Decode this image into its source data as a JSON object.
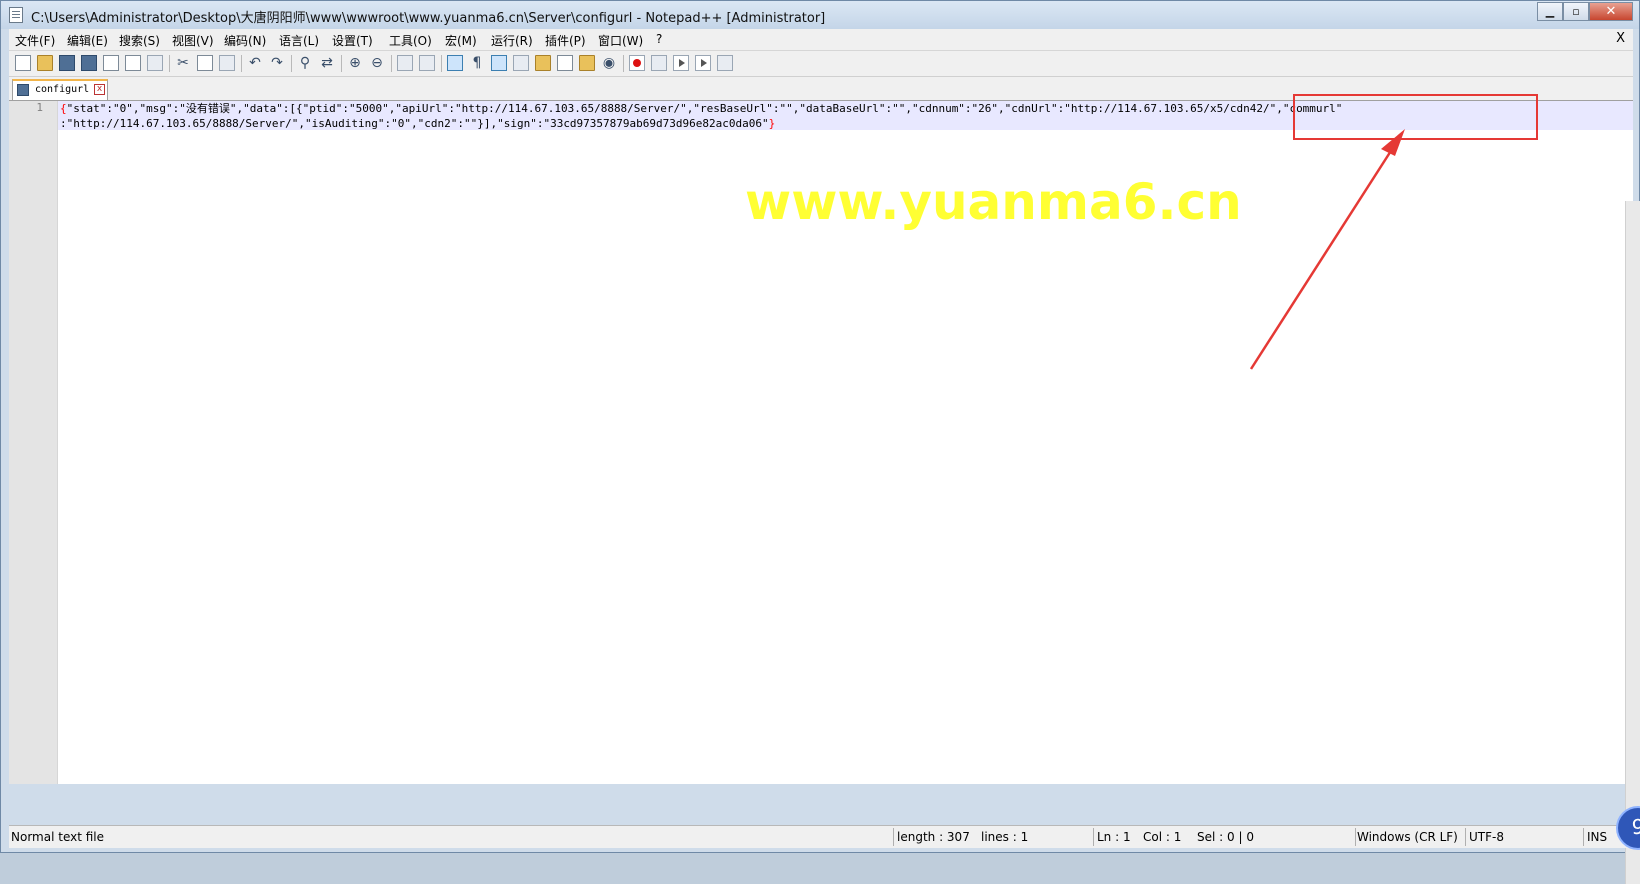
{
  "window": {
    "title": "C:\\Users\\Administrator\\Desktop\\大唐阴阳师\\www\\wwwroot\\www.yuanma6.cn\\Server\\configurl - Notepad++ [Administrator]",
    "minimize_icon": "minimize-icon",
    "maximize_icon": "maximize-icon",
    "close_icon": "close-icon"
  },
  "menu": {
    "items": [
      "文件(F)",
      "编辑(E)",
      "搜索(S)",
      "视图(V)",
      "编码(N)",
      "语言(L)",
      "设置(T)",
      "工具(O)",
      "宏(M)",
      "运行(R)",
      "插件(P)",
      "窗口(W)",
      "?"
    ],
    "close_label": "X"
  },
  "tab": {
    "label": "configurl",
    "close_label": "x"
  },
  "editor": {
    "line_number": "1",
    "line1_open": "{",
    "line1_rest": "\"stat\":\"0\",\"msg\":\"没有错误\",\"data\":[{\"ptid\":\"5000\",\"apiUrl\":\"http://114.67.103.65/8888/Server/\",\"resBaseUrl\":\"\",\"dataBaseUrl\":\"\",\"cdnnum\":\"26\",\"cdnUrl\":\"http://114.67.103.65/x5/cdn42/\",\"commurl\"",
    "line2_main": ":\"http://114.67.103.65/8888/Server/\",\"isAuditing\":\"0\",\"cdn2\":\"\"}],\"sign\":\"33cd97357879ab69d73d96e82ac0da06\"",
    "line2_close": "}"
  },
  "overlay": {
    "watermark": "www.yuanma6.cn",
    "highlight_color": "#e53935",
    "watermark_color": "#ffff33"
  },
  "status": {
    "file_type": "Normal text file",
    "length": "length : 307",
    "lines": "lines : 1",
    "ln": "Ln : 1",
    "col": "Col : 1",
    "sel": "Sel : 0 | 0",
    "eol": "Windows (CR LF)",
    "encoding": "UTF-8",
    "mode": "INS"
  },
  "badge": {
    "label": "9"
  }
}
